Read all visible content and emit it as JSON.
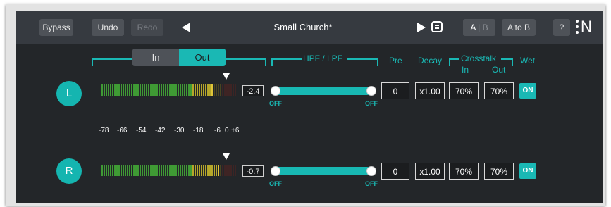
{
  "toolbar": {
    "bypass": "Bypass",
    "undo": "Undo",
    "redo": "Redo",
    "preset_name": "Small Church*",
    "ab_a": "A",
    "ab_sep": "|",
    "ab_b": "B",
    "a_to_b": "A to B",
    "help": "?",
    "logo": "N"
  },
  "meter_tabs": [
    "In",
    "Out"
  ],
  "selected_meter_tab": "Out",
  "headers": {
    "filter": "HPF / LPF",
    "pre": "Pre",
    "decay": "Decay",
    "crosstalk": "Crosstalk",
    "crosstalk_in": "In",
    "crosstalk_out": "Out",
    "wet": "Wet"
  },
  "scale_labels": [
    "-78",
    "-66",
    "-54",
    "-42",
    "-30",
    "-18",
    "-6",
    "0",
    "+6"
  ],
  "channels": [
    {
      "label": "L",
      "peak": "-2.4",
      "meter_level": 0.82,
      "filter_low_label": "OFF",
      "filter_high_label": "OFF",
      "pre": "0",
      "decay": "x1.00",
      "crosstalk_in": "70%",
      "crosstalk_out": "70%",
      "wet": "ON"
    },
    {
      "label": "R",
      "peak": "-0.7",
      "meter_level": 0.86,
      "filter_low_label": "OFF",
      "filter_high_label": "OFF",
      "pre": "0",
      "decay": "x1.00",
      "crosstalk_in": "70%",
      "crosstalk_out": "70%",
      "wet": "ON"
    }
  ],
  "colors": {
    "accent": "#1ab8b4",
    "panel": "#232629",
    "toolbar": "#363a40"
  },
  "icons": {
    "prev": "triangle-left-icon",
    "next": "triangle-right-icon",
    "preset_list": "list-icon"
  }
}
